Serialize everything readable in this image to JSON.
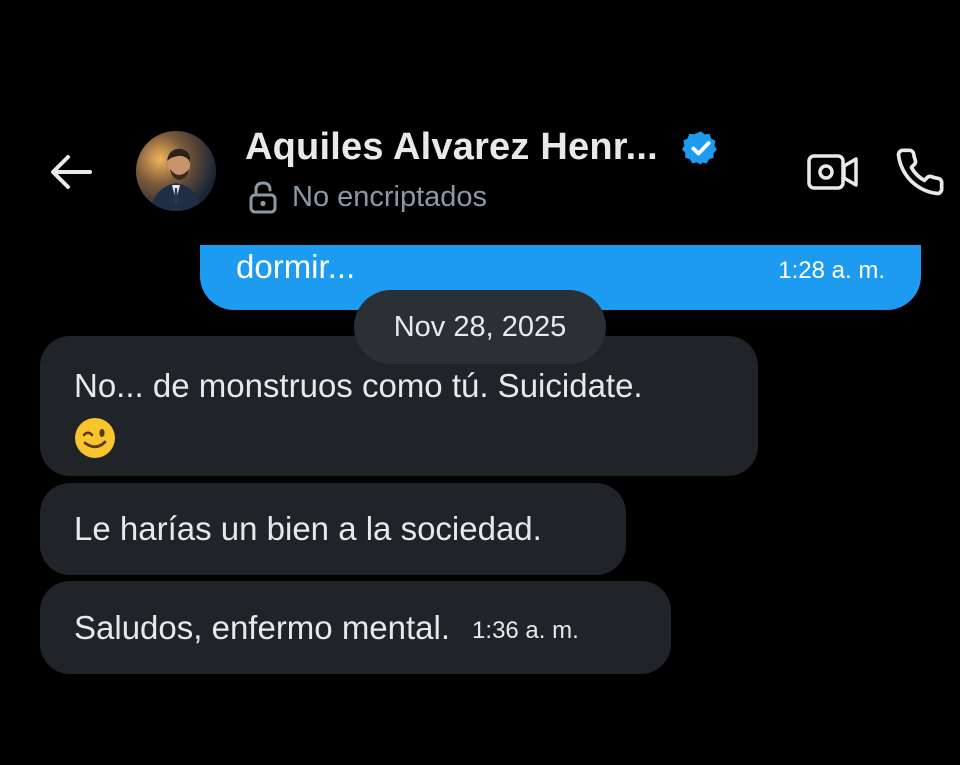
{
  "header": {
    "contact_name": "Aquiles Alvarez Henr...",
    "encryption_status": "No encriptados",
    "icons": [
      "back-arrow-icon",
      "verified-badge-icon",
      "lock-open-icon",
      "video-camera-icon",
      "phone-icon"
    ]
  },
  "colors": {
    "background": "#000000",
    "sent_bubble": "#1d9bf0",
    "received_bubble": "#202327",
    "date_pill": "#2a3036",
    "verified": "#1d9bf0",
    "muted_text": "#8b98a5"
  },
  "messages": {
    "sent_last": {
      "text": "dormir...",
      "time": "1:28 a. m."
    },
    "date_separator": "Nov 28, 2025",
    "received": [
      {
        "text": "No... de monstruos como tú. Suicidate.",
        "emoji": "winking-face-emoji"
      },
      {
        "text": "Le harías un bien a la sociedad."
      },
      {
        "text": "Saludos, enfermo mental.",
        "time": "1:36 a. m."
      }
    ]
  }
}
